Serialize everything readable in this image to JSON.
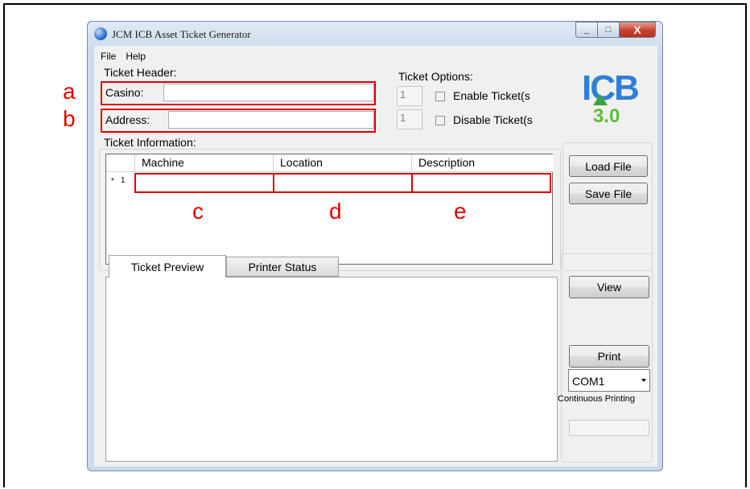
{
  "annotations": [
    "a",
    "b",
    "c",
    "d",
    "e"
  ],
  "window": {
    "title": "JCM ICB Asset Ticket Generator",
    "min": "_",
    "max": "□",
    "close": "X"
  },
  "menu": {
    "file": "File",
    "help": "Help"
  },
  "ticket_header": {
    "label": "Ticket Header:",
    "casino_label": "Casino:",
    "casino_value": "",
    "address_label": "Address:",
    "address_value": ""
  },
  "ticket_options": {
    "label": "Ticket Options:",
    "enable_count": "1",
    "enable_label": "Enable Ticket(s",
    "disable_count": "1",
    "disable_label": "Disable Ticket(s"
  },
  "logo": {
    "icb": "ICB",
    "version": "3.0"
  },
  "ticket_information": {
    "label": "Ticket Information:",
    "columns": [
      "Machine",
      "Location",
      "Description"
    ],
    "row_marker": "*",
    "row_number": "1"
  },
  "buttons": {
    "load_file": "Load File",
    "save_file": "Save File",
    "view": "View",
    "print": "Print"
  },
  "tabs": {
    "preview": "Ticket Preview",
    "printer_status": "Printer Status"
  },
  "port": {
    "selected": "COM1"
  },
  "continuous_printing": "Continuous Printing"
}
